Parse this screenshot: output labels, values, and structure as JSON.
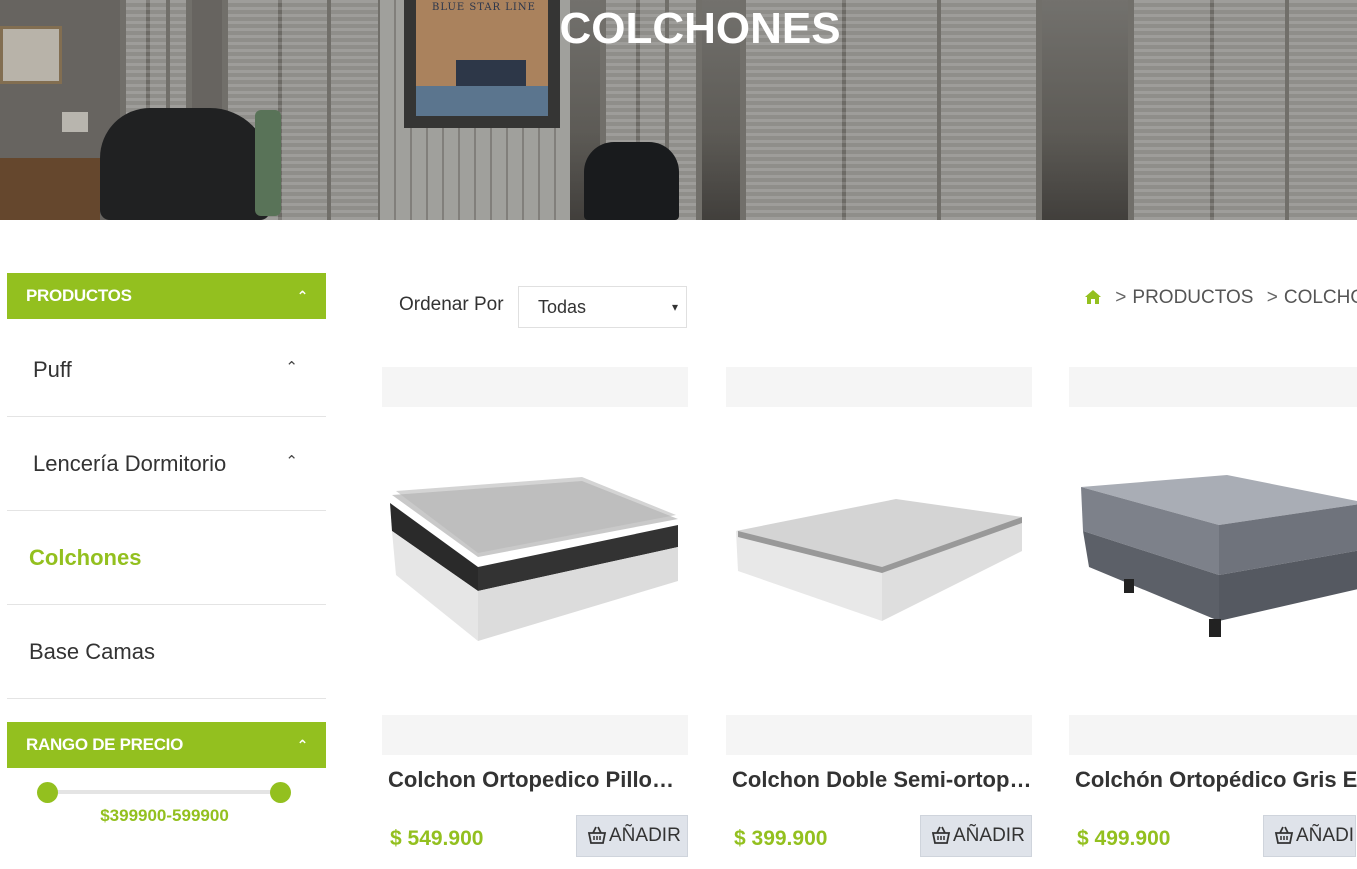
{
  "hero": {
    "title": "COLCHONES",
    "poster_text": "BLUE STAR LINE"
  },
  "sidebar": {
    "products_header": "PRODUCTOS",
    "categories": [
      {
        "label": "Puff",
        "expandable": true,
        "active": false
      },
      {
        "label": "Lencería Dormitorio",
        "expandable": true,
        "active": false
      },
      {
        "label": "Colchones",
        "expandable": false,
        "active": true
      },
      {
        "label": "Base Camas",
        "expandable": false,
        "active": false
      }
    ],
    "price_header": "RANGO DE PRECIO",
    "price_range": {
      "text": "$399900-599900",
      "min": 399900,
      "max": 599900
    }
  },
  "toolbar": {
    "sort_label": "Ordenar Por",
    "sort_value": "Todas",
    "breadcrumb": [
      "PRODUCTOS",
      "COLCHONES"
    ]
  },
  "products": [
    {
      "name": "Colchon Ortopedico Pillow Top",
      "price": "$ 549.900",
      "add_label": "AÑADIR"
    },
    {
      "name": "Colchon Doble Semi-ortopedico",
      "price": "$ 399.900",
      "add_label": "AÑADIR"
    },
    {
      "name": "Colchón Ortopédico Gris En",
      "price": "$ 499.900",
      "add_label": "AÑADIR"
    }
  ],
  "colors": {
    "accent": "#93c01f",
    "button_bg": "#dfe3ea"
  }
}
